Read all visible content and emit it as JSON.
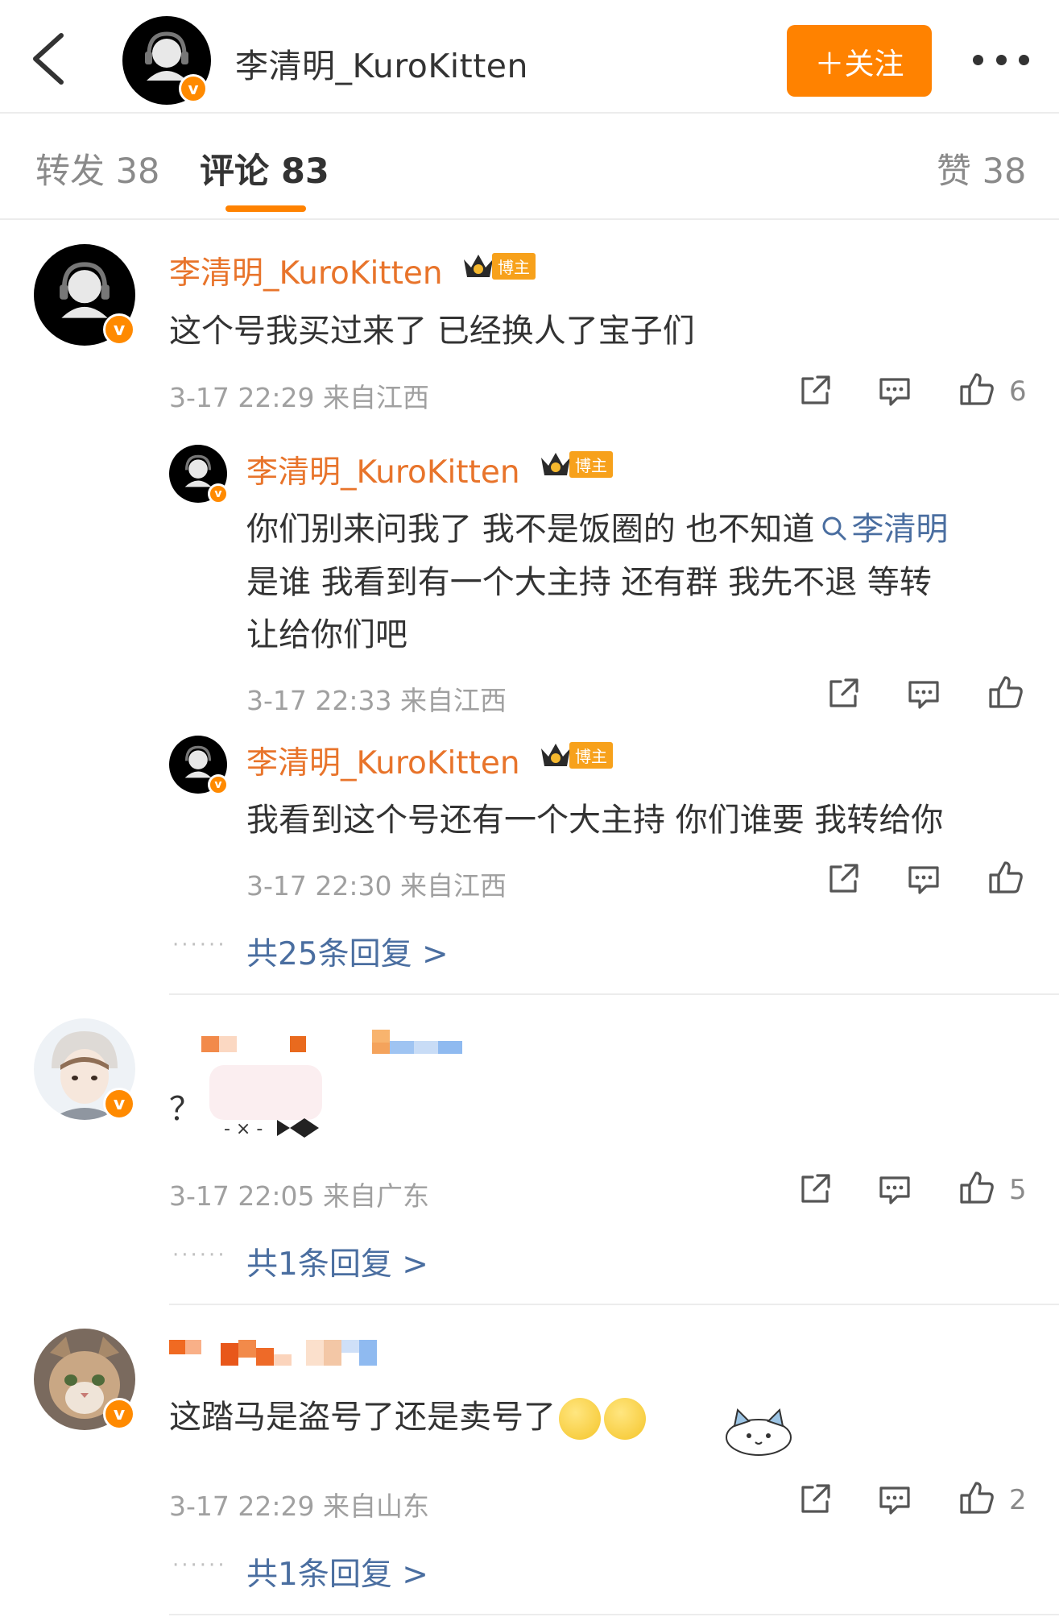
{
  "header": {
    "back_icon": "chevron-left-icon",
    "title": "李清明_KuroKitten",
    "follow_label": "＋关注",
    "more_icon": "more-icon",
    "accent": "#ff8200"
  },
  "tabs": [
    {
      "label": "转发 38"
    },
    {
      "label": "评论 83"
    },
    {
      "label": "赞 38"
    }
  ],
  "comments": [
    {
      "user": "李清明_KuroKitten",
      "badge": "博主",
      "text": "这个号我买过来了 已经换人了宝子们",
      "meta": "3-17 22:29 来自江西",
      "likes": "6",
      "replies": [
        {
          "user": "李清明_KuroKitten",
          "badge": "博主",
          "text_line1": "你们别来问我了 我不是饭圈的 也不知道",
          "mention": "李清明",
          "text_line2": "是谁 我看到有一个大主持 还有群 我先不退 等转",
          "text_line3": "让给你们吧",
          "meta": "3-17 22:33 来自江西"
        },
        {
          "user": "李清明_KuroKitten",
          "badge": "博主",
          "text": "我看到这个号还有一个大主持 你们谁要 我转给你",
          "meta": "3-17 22:30 来自江西"
        }
      ],
      "dots": "······",
      "reply_link": "共25条回复 >"
    },
    {
      "text": "？",
      "meta": "3-17 22:05 来自广东",
      "likes": "5",
      "dots": "······",
      "reply_link": "共1条回复 >"
    },
    {
      "text": "这踏马是盗号了还是卖号了",
      "meta": "3-17 22:29 来自山东",
      "likes": "2",
      "dots": "······",
      "reply_link": "共1条回复 >"
    }
  ]
}
